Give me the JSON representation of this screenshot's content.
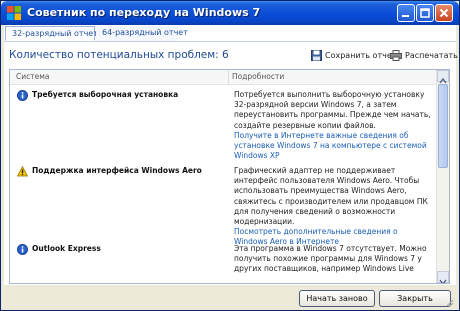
{
  "window": {
    "title": "Советник по переходу на Windows 7",
    "app_icon": "windows-flag-icon",
    "controls": [
      "minimize-icon",
      "maximize-icon",
      "close-icon"
    ]
  },
  "tabs": [
    {
      "label": "32-разрядный отчет",
      "active": true
    },
    {
      "label": "64-разрядный отчет",
      "active": false
    }
  ],
  "header": {
    "count_title": "Количество потенциальных проблем: 6",
    "save_label": "Сохранить отчет",
    "print_label": "Распечатать"
  },
  "table": {
    "columns": [
      "Система",
      "Подробности"
    ],
    "issues": [
      {
        "icon": "info-icon",
        "name": "Требуется выборочная установка",
        "desc": "Потребуется выполнить выборочную установку 32-разрядной версии Windows 7, а затем переустановить программы. Прежде чем начать, создайте резервные копии файлов.",
        "link": "Получите в Интернете важные сведения об установке Windows 7 на компьютере с системой Windows XP"
      },
      {
        "icon": "warning-icon",
        "name": "Поддержка интерфейса Windows Aero",
        "desc": "Графический адаптер не поддерживает интерфейс пользователя Windows Aero. Чтобы использовать преимущества Windows Aero, свяжитесь с производителем или продавцом ПК для получения сведений о возможности модернизации.",
        "link": "Посмотреть дополнительные сведения о Windows Aero в Интернете"
      },
      {
        "icon": "info-icon",
        "name": "Outlook Express",
        "desc": "Эта программа в Windows 7 отсутствует. Можно получить похожие программы для Windows 7 у других поставщиков, например Windows Live",
        "link": ""
      }
    ]
  },
  "footer": {
    "restart_label": "Начать заново",
    "close_label": "Закрыть"
  },
  "colors": {
    "titlebar": "#0a4fd8",
    "accent_text": "#1e4a97",
    "link": "#1a5fb4"
  }
}
